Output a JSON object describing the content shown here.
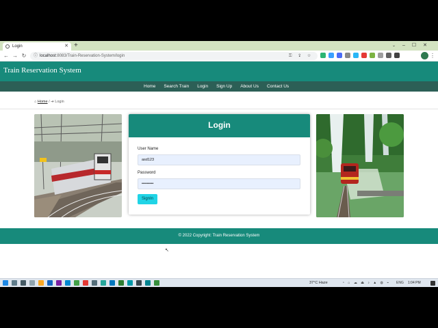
{
  "browser": {
    "tab_title": "Login",
    "new_tab_icon": "+",
    "address_host": "localhost",
    "address_rest": ":8083/Train-Reservation-System/login"
  },
  "site": {
    "title": "Train Reservation System",
    "nav": [
      "Home",
      "Search Train",
      "Login",
      "Sign Up",
      "About Us",
      "Contact Us"
    ]
  },
  "breadcrumb": {
    "home": "Home",
    "separator": "/",
    "current": "Login"
  },
  "login": {
    "title": "Login",
    "username_label": "User Name",
    "username_value": "asd123",
    "password_label": "Password",
    "password_value": "•••••••••",
    "submit_label": "SignIn"
  },
  "footer": {
    "text": "© 2022 Copyright: Train Reservation System"
  },
  "taskbar": {
    "weather": "37°C Haze",
    "language": "ENG",
    "time": "1:04 PM"
  },
  "colors": {
    "primary": "#178a7b",
    "navbar": "#2c5f56",
    "button": "#20d4e6"
  }
}
